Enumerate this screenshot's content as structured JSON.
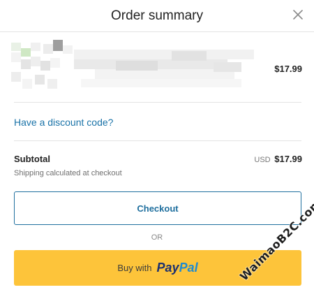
{
  "header": {
    "title": "Order summary"
  },
  "product": {
    "price": "$17.99"
  },
  "discount": {
    "link_text": "Have a discount code?"
  },
  "summary": {
    "subtotal_label": "Subtotal",
    "subtotal_currency": "USD",
    "subtotal_amount": "$17.99",
    "shipping_note": "Shipping calculated at checkout"
  },
  "actions": {
    "checkout_label": "Checkout",
    "or_label": "OR",
    "paypal_prefix": "Buy with",
    "paypal_brand_part1": "Pay",
    "paypal_brand_part2": "Pal"
  },
  "watermark": {
    "text": "WaimaoB2C.com"
  },
  "colors": {
    "link": "#1a73a8",
    "checkout_border": "#1f6f9e",
    "paypal_button": "#fdc43a",
    "paypal_dark": "#1c3070",
    "paypal_light": "#1f8bd0"
  },
  "icons": {
    "close": "close-icon"
  }
}
